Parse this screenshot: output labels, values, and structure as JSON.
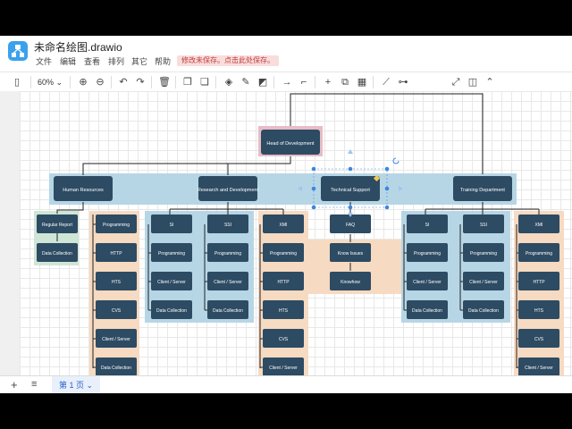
{
  "title": "未命名绘图.drawio",
  "menu": [
    "文件",
    "编辑",
    "查看",
    "排列",
    "其它",
    "帮助"
  ],
  "unsaved_notice": "修改未保存。点击此处保存。",
  "zoom": "60%",
  "page_tab": "第 1 页",
  "colors": {
    "node": "#2d4b63",
    "blue_group": "#b7d6e5",
    "orange_group": "#f6dac1",
    "pink_group": "#e8bcc6",
    "green_group": "#cfe6d6"
  },
  "nodes": {
    "head": "Head of Development",
    "hr": "Human Resources",
    "rd": "Research and Development",
    "ts": "Technical Support",
    "td": "Training Department",
    "rr": "Regular Report",
    "dc": "Data Collection",
    "prog": "Programming",
    "http": "HTTP",
    "hts": "HTS",
    "cvs": "CVS",
    "cs": "Client / Server",
    "si": "SI",
    "ssi": "SSI",
    "xmi": "XMI",
    "faq": "FAQ",
    "know": "Know Issues",
    "knowhow": "Knowhow"
  }
}
